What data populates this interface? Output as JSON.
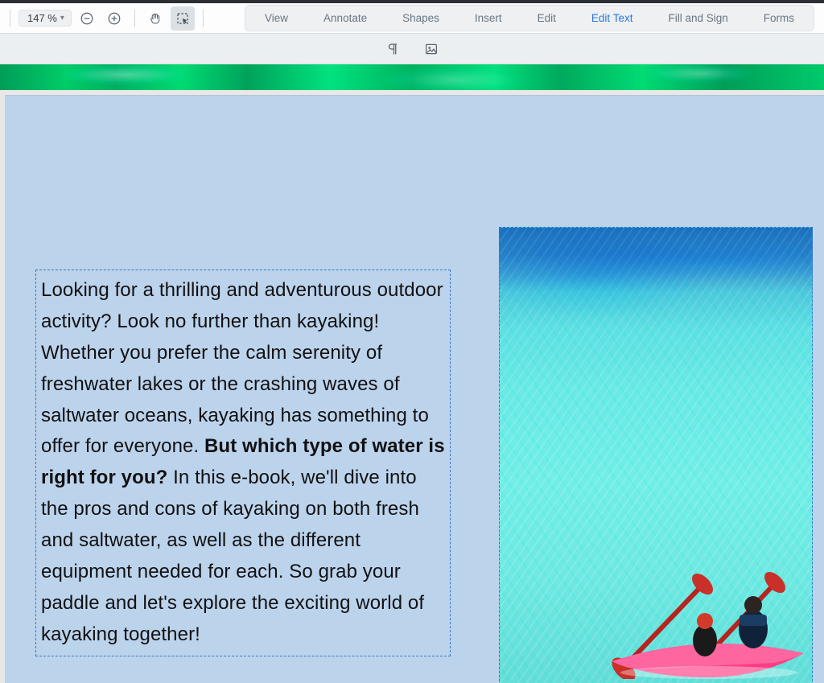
{
  "toolbar": {
    "zoom_level": "147 %",
    "tabs": {
      "view": "View",
      "annotate": "Annotate",
      "shapes": "Shapes",
      "insert": "Insert",
      "edit": "Edit",
      "edit_text": "Edit Text",
      "fill_sign": "Fill and Sign",
      "forms": "Forms"
    }
  },
  "document": {
    "text_block": {
      "part1": "Looking for a thrilling and adventurous outdoor activity? Look no further than kayaking! Whether you prefer the calm serenity of freshwater lakes or the crashing waves of saltwater oceans, kayaking has something to offer for everyone. ",
      "bold": "But which type of water is right for you?",
      "part2": " In this e-book, we'll dive into the pros and cons of kayaking on both fresh and saltwater, as well as the different equipment needed for each. So grab your paddle and let's explore the exciting world of kayaking together!"
    },
    "image_alt": "Two people paddling a pink kayak on turquoise tropical water"
  }
}
